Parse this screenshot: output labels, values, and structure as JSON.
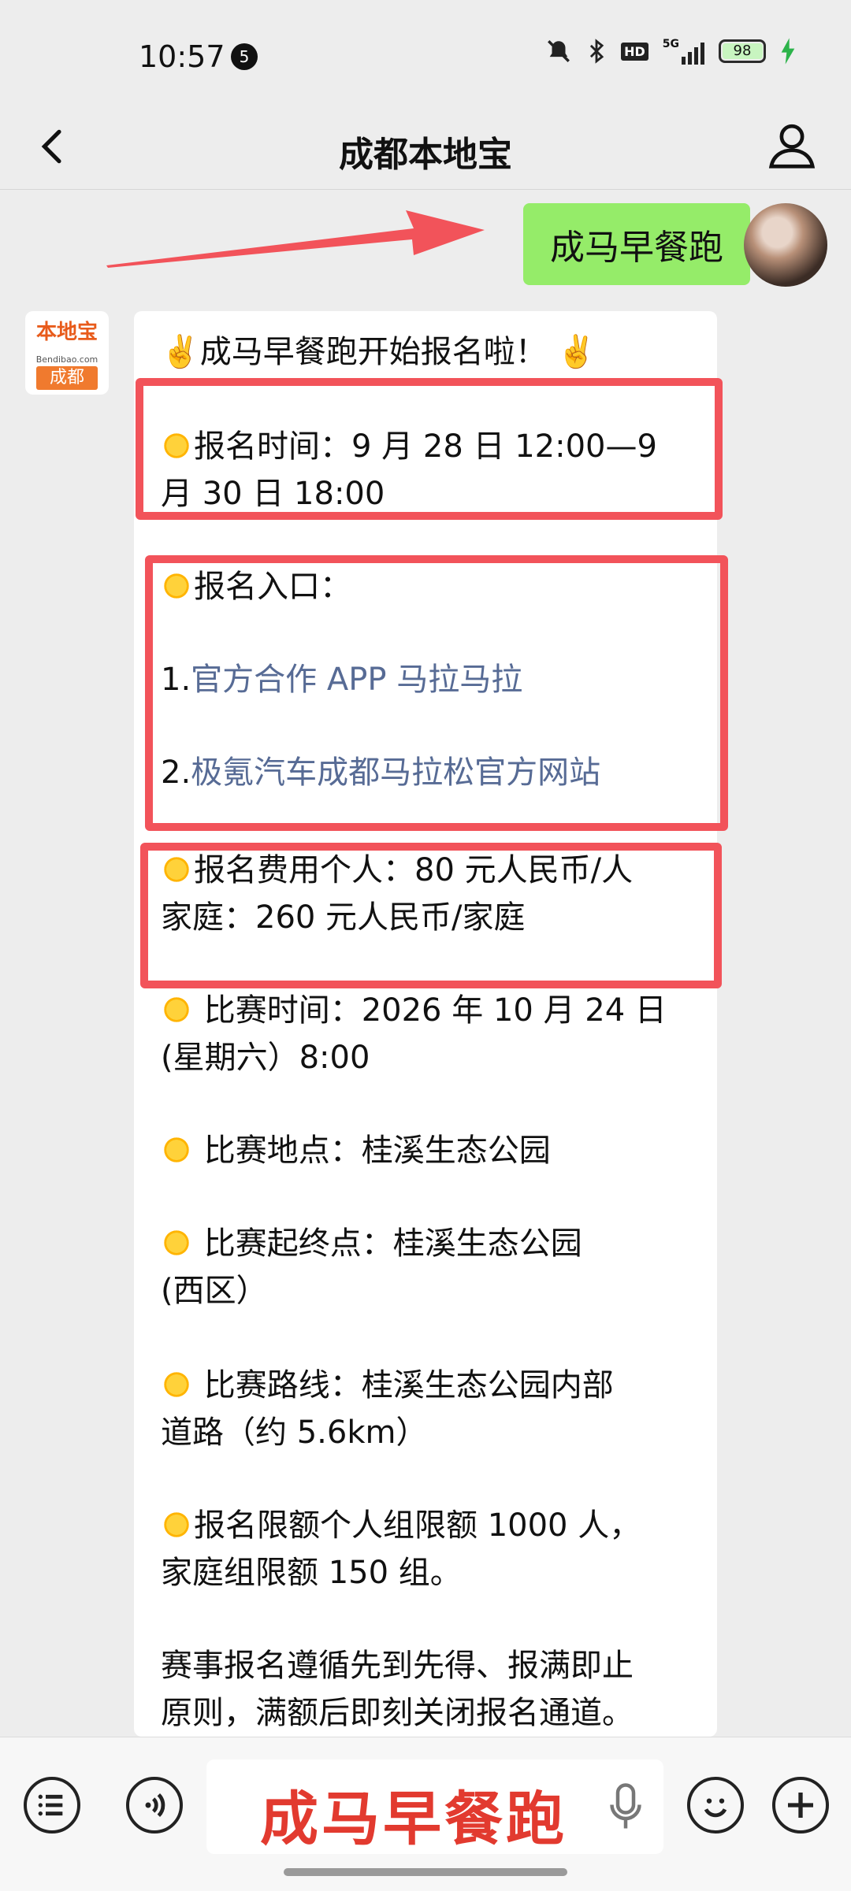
{
  "status_bar": {
    "time": "10:57",
    "notification_count": "5",
    "network": "5G",
    "hd_label": "HD",
    "battery": "98"
  },
  "header": {
    "title": "成都本地宝"
  },
  "user_message": "成马早餐跑",
  "bot_avatar": {
    "top_text": "本地宝",
    "site": "Bendibao.com",
    "city": "成都"
  },
  "bot_message": {
    "line_title": "✌️成马早餐跑开始报名啦！ ✌️",
    "reg_time_label": "报名时间：9 月 28 日 12:00—9",
    "reg_time_cont": "月 30 日 18:00",
    "entry_label": "报名入口：",
    "entry_1_num": "1.",
    "entry_1_link": "官方合作 APP 马拉马拉",
    "entry_2_num": "2.",
    "entry_2_link": "极氪汽车成都马拉松官方网站",
    "fee_line1": "报名费用个人：80 元人民币/人",
    "fee_line2": "家庭：260 元人民币/家庭",
    "race_time_line1": " 比赛时间：2026 年 10 月 24 日",
    "race_time_line2": "(星期六）8:00",
    "venue": " 比赛地点：桂溪生态公园",
    "start_end_line1": " 比赛起终点：桂溪生态公园",
    "start_end_line2": "(西区）",
    "route_line1": " 比赛路线：桂溪生态公园内部",
    "route_line2": "道路（约 5.6km）",
    "quota_line1": "报名限额个人组限额 1000 人，",
    "quota_line2": "家庭组限额 150 组。",
    "rule_line1": "赛事报名遵循先到先得、报满即止",
    "rule_line2": "原则，满额后即刻关闭报名通道。"
  },
  "input_bar": {
    "overlay_text": "成马早餐跑"
  }
}
